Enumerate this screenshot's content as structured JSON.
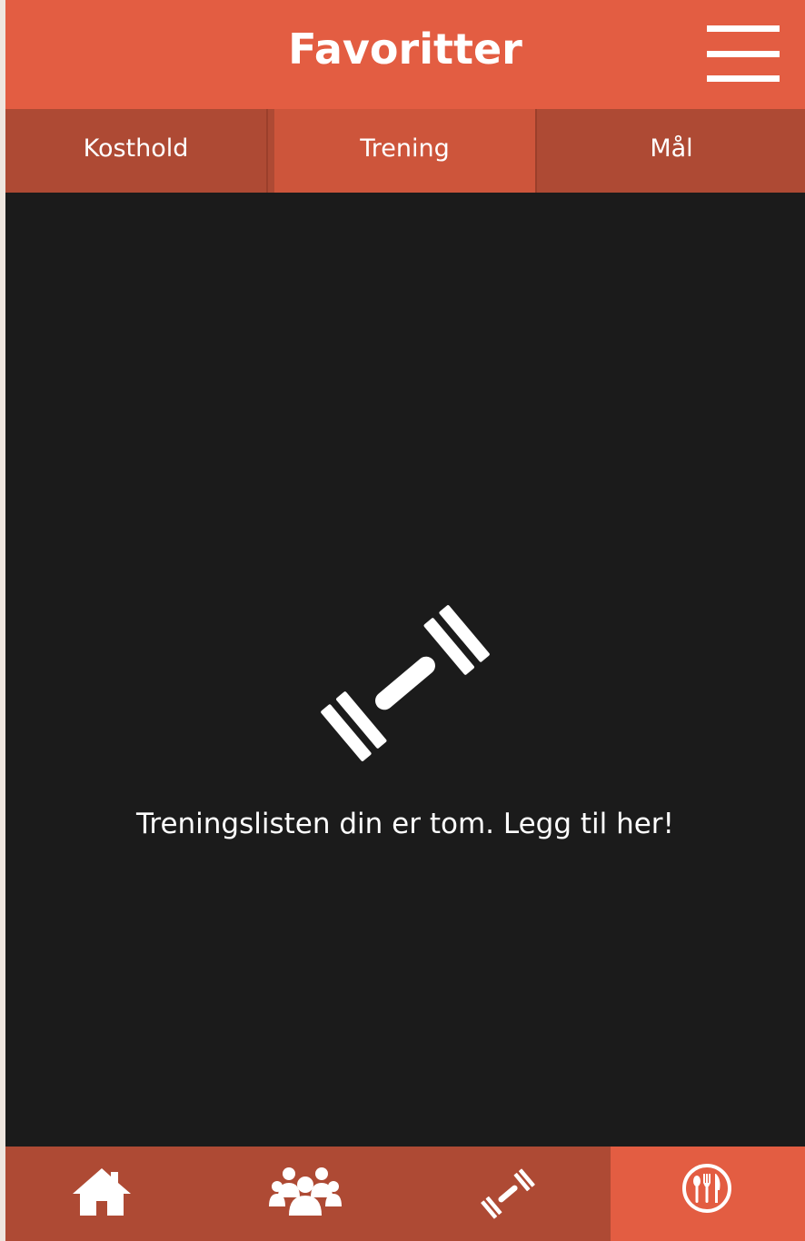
{
  "header": {
    "title": "Favoritter",
    "menu_icon": "hamburger-menu-icon"
  },
  "tabs": [
    {
      "label": "Kosthold",
      "selected": false
    },
    {
      "label": "Trening",
      "selected": true
    },
    {
      "label": "Mål",
      "selected": false
    }
  ],
  "empty_state": {
    "icon": "dumbbell-icon",
    "message": "Treningslisten din er tom. Legg til her!"
  },
  "bottom_nav": {
    "items": [
      {
        "icon": "home-icon",
        "active": false
      },
      {
        "icon": "users-group-icon",
        "active": false
      },
      {
        "icon": "dumbbell-icon",
        "active": false
      },
      {
        "icon": "cutlery-icon",
        "active": true
      }
    ]
  },
  "colors": {
    "header": "#e35d42",
    "tab_bar": "#ae4a34",
    "tab_selected": "#cd553b",
    "background": "#1b1b1b",
    "text": "#ffffff"
  }
}
